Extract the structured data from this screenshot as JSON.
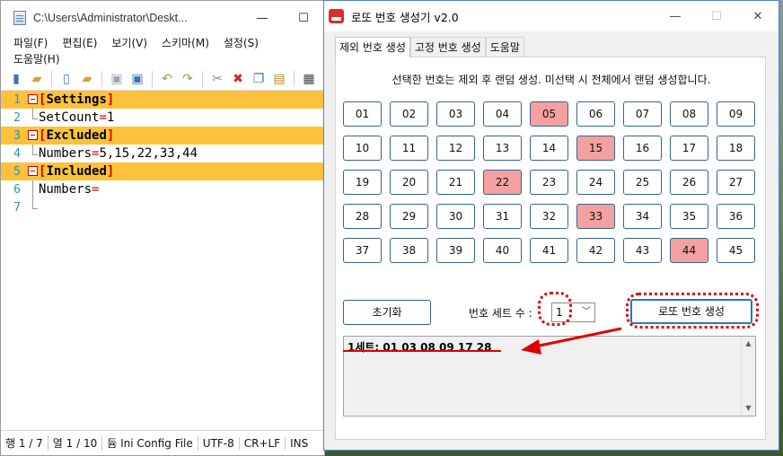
{
  "notepad": {
    "title": "C:\\Users\\Administrator\\Deskt...",
    "window_buttons": [
      "—",
      "☐"
    ],
    "menu_row1": [
      "파일(F)",
      "편집(E)",
      "보기(V)",
      "스키마(M)",
      "설정(S)"
    ],
    "menu_row2": [
      "도움말(H)"
    ],
    "toolbar_icons": [
      "book-icon",
      "open-folder-icon",
      "new-file-icon",
      "open-file-icon",
      "save-icon",
      "save-all-icon",
      "undo-icon",
      "redo-icon",
      "cut-icon",
      "delete-icon",
      "copy-icon",
      "paste-icon",
      "more-icon"
    ],
    "lines": [
      {
        "n": "1",
        "key": "",
        "val": "",
        "section": "Settings"
      },
      {
        "n": "2",
        "key": "SetCount",
        "val": "1",
        "section": ""
      },
      {
        "n": "3",
        "key": "",
        "val": "",
        "section": "Excluded"
      },
      {
        "n": "4",
        "key": "Numbers",
        "val": "5,15,22,33,44",
        "section": ""
      },
      {
        "n": "5",
        "key": "",
        "val": "",
        "section": "Included"
      },
      {
        "n": "6",
        "key": "Numbers",
        "val": "",
        "section": ""
      },
      {
        "n": "7",
        "key": "",
        "val": "",
        "section": ""
      }
    ],
    "status": [
      "행 1 / 7",
      "열 1 / 10",
      "듐 Ini Config File",
      "UTF-8",
      "CR+LF",
      "INS"
    ]
  },
  "lotto": {
    "title": "로또 번호 생성기 v2.0",
    "tabs": [
      "제외 번호 생성",
      "고정 번호 생성",
      "도움말"
    ],
    "description": "선택한 번호는 제외 후 랜덤 생성. 미선택 시 전체에서 랜덤 생성합니다.",
    "numbers": [
      "01",
      "02",
      "03",
      "04",
      "05",
      "06",
      "07",
      "08",
      "09",
      "10",
      "11",
      "12",
      "13",
      "14",
      "15",
      "16",
      "17",
      "18",
      "19",
      "20",
      "21",
      "22",
      "23",
      "24",
      "25",
      "26",
      "27",
      "28",
      "29",
      "30",
      "31",
      "32",
      "33",
      "34",
      "35",
      "36",
      "37",
      "38",
      "39",
      "40",
      "41",
      "42",
      "43",
      "44",
      "45"
    ],
    "excluded": [
      "05",
      "15",
      "22",
      "33",
      "44"
    ],
    "reset_label": "초기화",
    "set_count_label": "번호 세트 수 :",
    "set_count_value": "1",
    "generate_label": "로또 번호 생성",
    "result": "1세트: 01 03 08 09 17 28",
    "colors": {
      "excluded_bg": "#f4a0a0",
      "annotation": "#e10000",
      "accent": "#2a73c8"
    }
  }
}
